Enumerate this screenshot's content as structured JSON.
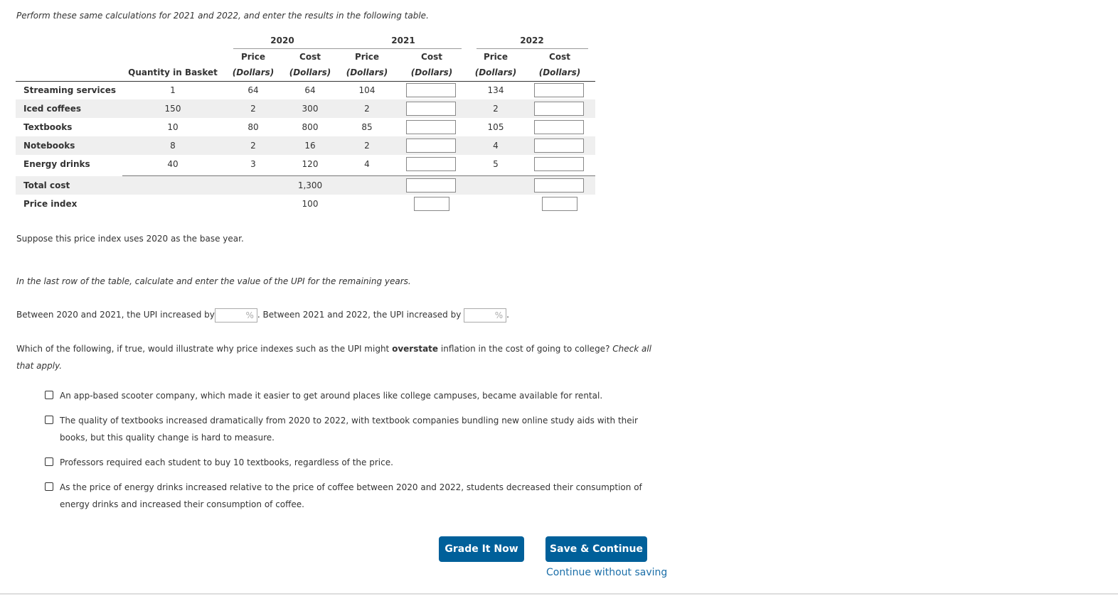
{
  "intro": "Perform these same calculations for 2021 and 2022, and enter the results in the following table.",
  "table": {
    "years": [
      "2020",
      "2021",
      "2022"
    ],
    "col_price": "Price",
    "col_cost": "Cost",
    "col_unit": "(Dollars)",
    "col_quantity": "Quantity in Basket",
    "rows": [
      {
        "label": "Streaming services",
        "qty": "1",
        "p2020": "64",
        "c2020": "64",
        "p2021": "104",
        "p2022": "134"
      },
      {
        "label": "Iced coffees",
        "qty": "150",
        "p2020": "2",
        "c2020": "300",
        "p2021": "2",
        "p2022": "2"
      },
      {
        "label": "Textbooks",
        "qty": "10",
        "p2020": "80",
        "c2020": "800",
        "p2021": "85",
        "p2022": "105"
      },
      {
        "label": "Notebooks",
        "qty": "8",
        "p2020": "2",
        "c2020": "16",
        "p2021": "2",
        "p2022": "4"
      },
      {
        "label": "Energy drinks",
        "qty": "40",
        "p2020": "3",
        "c2020": "120",
        "p2021": "4",
        "p2022": "5"
      }
    ],
    "total_label": "Total cost",
    "total_2020": "1,300",
    "index_label": "Price index",
    "index_2020": "100"
  },
  "base_year_text": "Suppose this price index uses 2020 as the base year.",
  "last_row_instruction": "In the last row of the table, calculate and enter the value of the UPI for the remaining years.",
  "upi": {
    "text1": "Between 2020 and 2021, the UPI increased by",
    "text2": ". Between 2021 and 2022, the UPI increased by",
    "text3": ".",
    "percent": "%"
  },
  "question": {
    "before": "Which of the following, if true, would illustrate why price indexes such as the UPI might ",
    "bold": "overstate",
    "after": " inflation in the cost of going to college? ",
    "hint": "Check all that apply."
  },
  "options": [
    "An app-based scooter company, which made it easier to get around places like college campuses, became available for rental.",
    "The quality of textbooks increased dramatically from 2020 to 2022, with textbook companies bundling new online study aids with their books, but this quality change is hard to measure.",
    "Professors required each student to buy 10 textbooks, regardless of the price.",
    "As the price of energy drinks increased relative to the price of coffee between 2020 and 2022, students decreased their consumption of energy drinks and increased their consumption of coffee."
  ],
  "buttons": {
    "grade": "Grade It Now",
    "save": "Save & Continue",
    "continue": "Continue without saving"
  },
  "colors": {
    "button": "#00609a",
    "link": "#1a6ea8",
    "stripe": "#efefef"
  }
}
